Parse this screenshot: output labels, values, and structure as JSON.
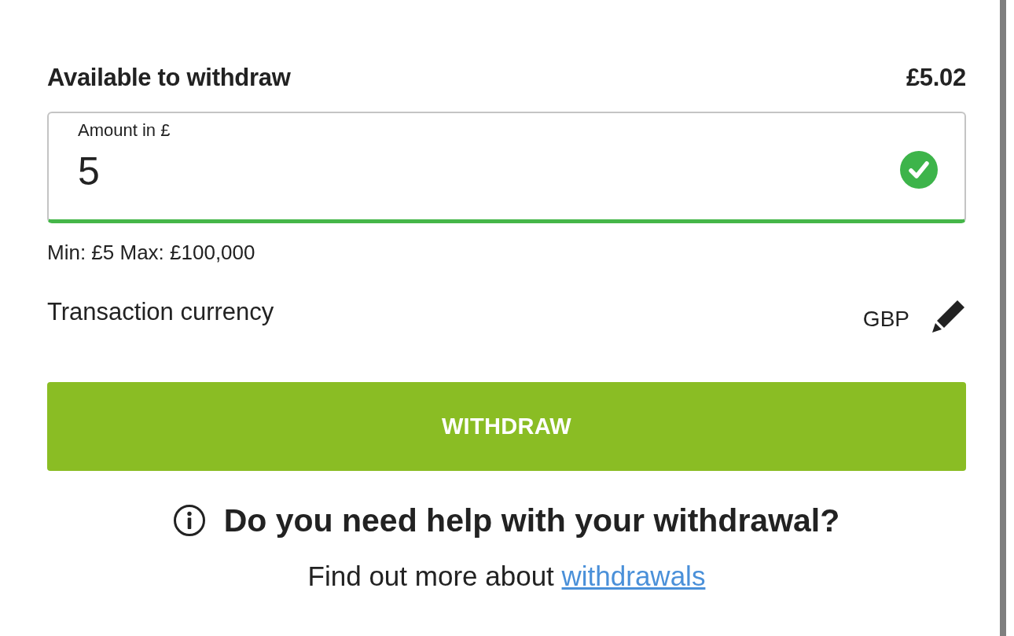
{
  "balance": {
    "label": "Available to withdraw",
    "value": "£5.02"
  },
  "amount_field": {
    "label": "Amount in £",
    "value": "5",
    "valid": true
  },
  "limits": "Min: £5 Max: £100,000",
  "currency": {
    "label": "Transaction currency",
    "value": "GBP"
  },
  "withdraw_button": {
    "label": "WITHDRAW"
  },
  "help": {
    "title": "Do you need help with your withdrawal?",
    "text": "Find out more about",
    "link": "withdrawals"
  }
}
